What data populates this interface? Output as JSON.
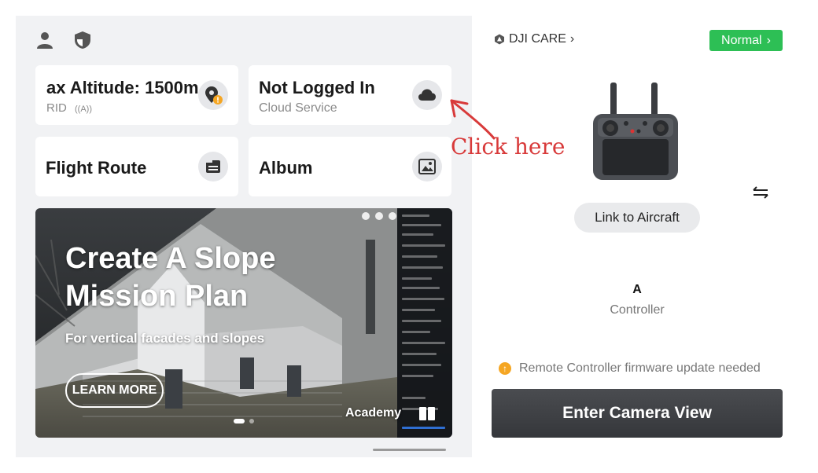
{
  "left": {
    "cards": {
      "altitude": {
        "title": "ax Altitude: 1500m",
        "sub": "RID",
        "sub_extra": "((A))"
      },
      "cloud": {
        "title": "Not Logged In",
        "sub": "Cloud Service"
      },
      "route": {
        "title": "Flight Route"
      },
      "album": {
        "title": "Album"
      }
    },
    "banner": {
      "title": "Create A Slope Mission Plan",
      "subtitle": "For vertical facades and slopes",
      "learn_more": "LEARN MORE",
      "academy": "Academy"
    }
  },
  "right": {
    "care_label": "DJI CARE",
    "status_label": "Normal",
    "link_label": "Link to Aircraft",
    "controller_name": "A",
    "controller_label": "Controller",
    "firmware_warning": "Remote Controller firmware update needed",
    "camera_button": "Enter Camera View"
  },
  "annotation": {
    "text": "Click here"
  },
  "colors": {
    "accent_green": "#2dbf55",
    "warning_orange": "#f5a623",
    "annotation_red": "#d83a3a"
  }
}
